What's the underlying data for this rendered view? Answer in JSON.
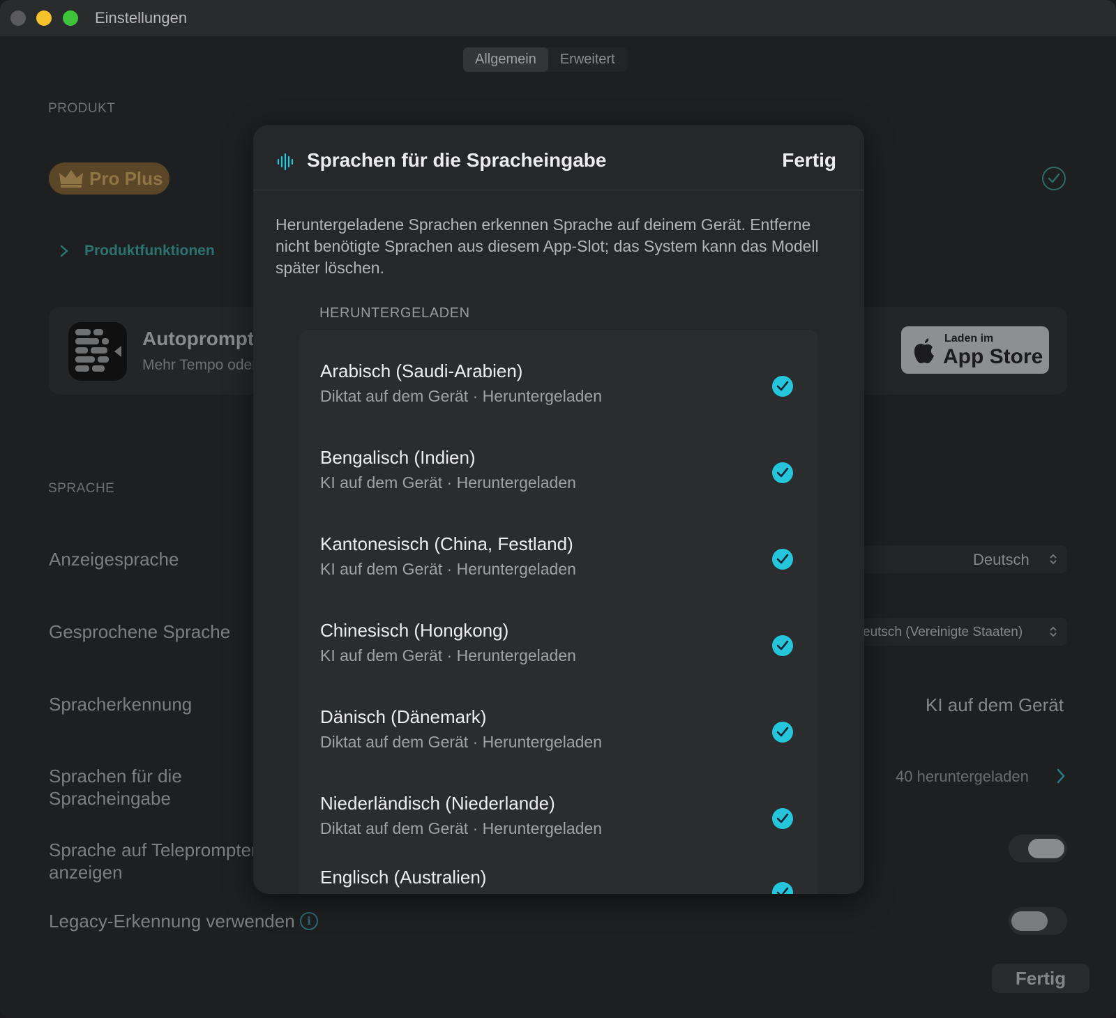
{
  "window": {
    "title": "Einstellungen"
  },
  "tabs": [
    {
      "label": "Allgemein",
      "active": true
    },
    {
      "label": "Erweitert",
      "active": false
    }
  ],
  "product": {
    "section_label": "PRODUKT",
    "badge_label": "Pro Plus",
    "features_link": "Produktfunktionen",
    "app": {
      "name": "Autoprompt",
      "subtitle": "Mehr Tempo oder",
      "store_small": "Laden im",
      "store_big": "App Store"
    }
  },
  "language": {
    "section_label": "SPRACHE",
    "rows": {
      "display_language": {
        "label": "Anzeigesprache",
        "value": "Deutsch"
      },
      "spoken_language": {
        "label": "Gesprochene Sprache",
        "value": "eutsch (Vereinigte Staaten)"
      },
      "recognition": {
        "label": "Spracherkennung",
        "value": "KI auf dem Gerät"
      },
      "input_languages": {
        "label": "Sprachen für die Spracheingabe",
        "value": "40 heruntergeladen"
      },
      "show_on_teleprompter": {
        "label": "Sprache auf Teleprompter anzeigen",
        "on": true
      },
      "legacy_recognition": {
        "label": "Legacy-Erkennung verwenden",
        "on": false
      }
    }
  },
  "footer": {
    "done_label": "Fertig"
  },
  "modal": {
    "title": "Sprachen für die Spracheingabe",
    "done_label": "Fertig",
    "description": "Heruntergeladene Sprachen erkennen Sprache auf deinem Gerät. Entferne nicht benötigte Sprachen aus diesem App-Slot; das System kann das Modell später löschen.",
    "section_label": "HERUNTERGELADEN",
    "languages": [
      {
        "name": "Arabisch (Saudi-Arabien)",
        "detail": "Diktat auf dem Gerät · Heruntergeladen"
      },
      {
        "name": "Bengalisch (Indien)",
        "detail": "KI auf dem Gerät · Heruntergeladen"
      },
      {
        "name": "Kantonesisch (China, Festland)",
        "detail": "KI auf dem Gerät · Heruntergeladen"
      },
      {
        "name": "Chinesisch (Hongkong)",
        "detail": "KI auf dem Gerät · Heruntergeladen"
      },
      {
        "name": "Dänisch (Dänemark)",
        "detail": "Diktat auf dem Gerät · Heruntergeladen"
      },
      {
        "name": "Niederländisch (Niederlande)",
        "detail": "Diktat auf dem Gerät · Heruntergeladen"
      },
      {
        "name": "Englisch (Australien)",
        "detail": ""
      }
    ]
  },
  "colors": {
    "accent_check": "#25c6dc",
    "teal_link": "#2b7370",
    "badge_gold": "#8f7546"
  }
}
